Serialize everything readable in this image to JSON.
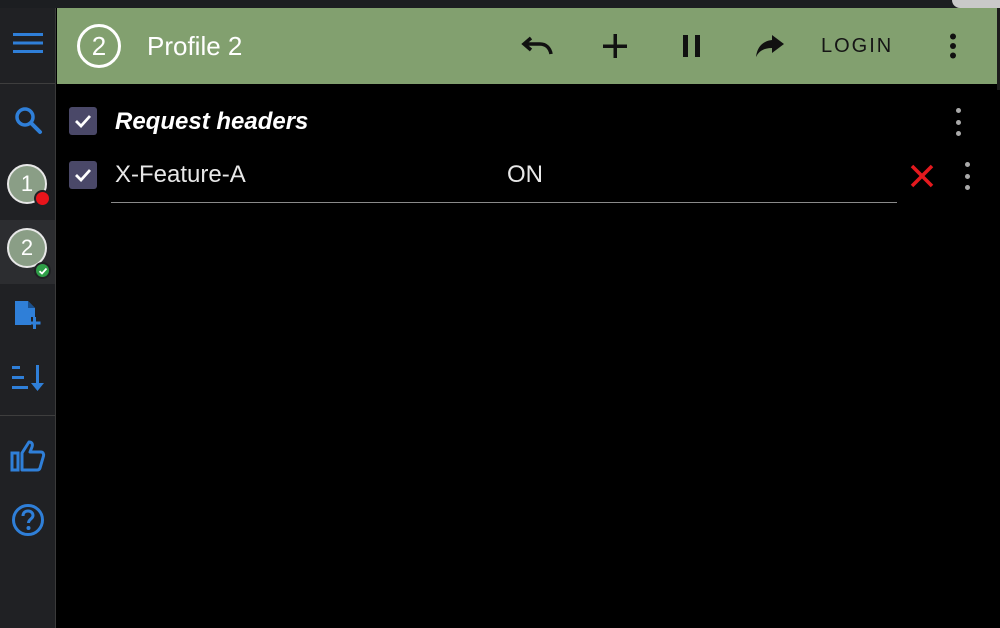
{
  "sidebar": {
    "menu_icon": "hamburger-icon",
    "search_icon": "search-icon",
    "profiles": [
      {
        "label": "1",
        "status": "inactive",
        "badge_color": "#e8141b"
      },
      {
        "label": "2",
        "status": "active",
        "badge_color": "#2e9e47"
      }
    ],
    "add_profile_icon": "add-document-icon",
    "sort_icon": "sort-icon",
    "like_icon": "thumbs-up-icon",
    "help_icon": "help-icon"
  },
  "header": {
    "profile_number": "2",
    "title": "Profile 2",
    "undo_icon": "undo-icon",
    "add_icon": "plus-icon",
    "pause_icon": "pause-icon",
    "redo_icon": "redo-icon",
    "login_label": "LOGIN",
    "more_icon": "more-vert-icon",
    "background_color": "#82a06f"
  },
  "section": {
    "title": "Request headers",
    "checked": true
  },
  "headers": [
    {
      "name": "X-Feature-A",
      "value": "ON",
      "enabled": true
    }
  ],
  "colors": {
    "accent_blue": "#2f7fd8",
    "delete_red": "#e5191e",
    "checkbox_bg": "#4a4868"
  }
}
